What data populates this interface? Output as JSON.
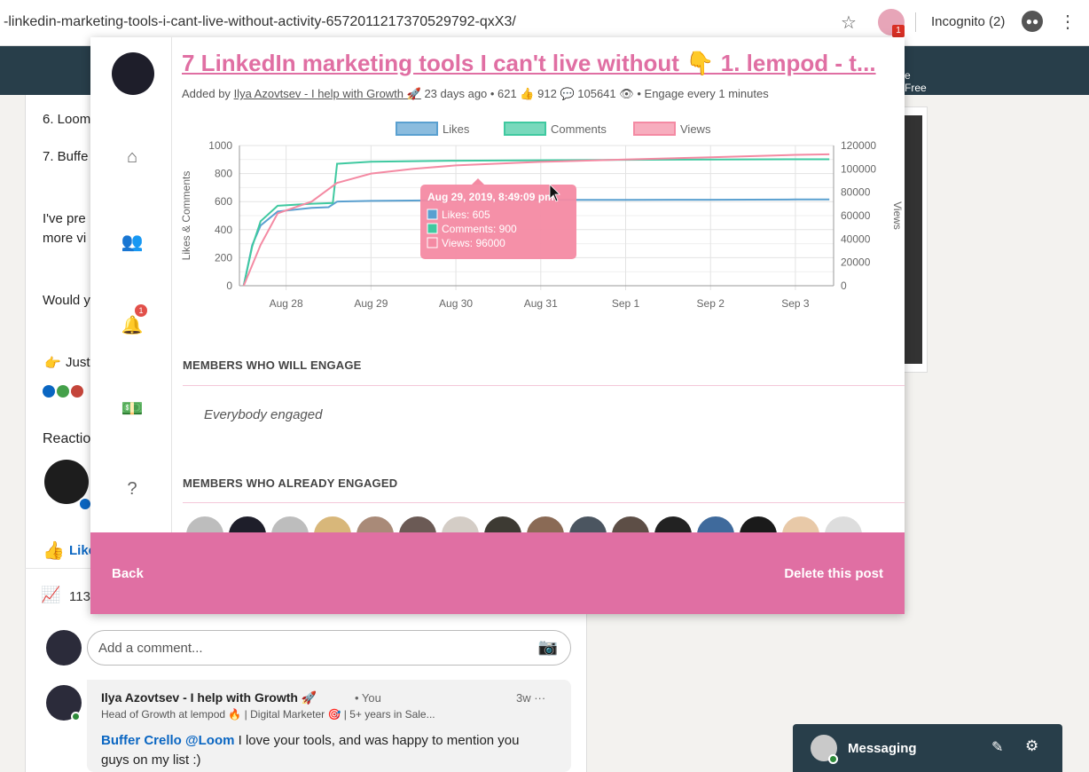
{
  "browser": {
    "url": "-linkedin-marketing-tools-i-cant-live-without-activity-6572011217370529792-qxX3/",
    "star_icon": "star-icon",
    "extension_badge": "1",
    "incognito_label": "Incognito (2)",
    "menu_icon": "kebab-icon"
  },
  "linkedin_nav": {
    "right_text_line1": "e",
    "right_text_line2": "Free"
  },
  "feed": {
    "lines": [
      "6. Loom",
      "7. Buffe",
      "I've pre",
      "more vi",
      "Would y",
      "Just"
    ],
    "reactions_label": "Reactio",
    "like_label": "Like",
    "stats_count": "113",
    "comment_placeholder": "Add a comment...",
    "comment": {
      "author": "Ilya Azovtsev - I help with Growth 🚀",
      "you": "• You",
      "time": "3w ···",
      "headline": "Head of Growth at lempod 🔥 | Digital Marketer 🎯 | 5+ years in Sale...",
      "mention1": "Buffer Crello",
      "mention2": "@Loom",
      "text": "I love your tools, and was happy to mention you guys on my list :)"
    }
  },
  "messaging": {
    "label": "Messaging"
  },
  "popup": {
    "title": "7 LinkedIn marketing tools I can't live without 👇 1. lempod - t...",
    "meta_prefix": "Added by",
    "meta_author": "Ilya Azovtsev - I help with Growth 🚀",
    "meta_rest": "23 days ago • 621 👍 912 💬 105641 👁 • Engage every 1 minutes",
    "notification_count": "1",
    "section_will_engage": "MEMBERS WHO WILL ENGAGE",
    "everybody_engaged": "Everybody engaged",
    "section_already_engaged": "MEMBERS WHO ALREADY ENGAGED",
    "back_label": "Back",
    "delete_label": "Delete this post",
    "accent_color": "#e06fa3"
  },
  "chart_data": {
    "type": "line",
    "x_labels": [
      "Aug 28",
      "Aug 29",
      "Aug 30",
      "Aug 31",
      "Sep 1",
      "Sep 2",
      "Sep 3"
    ],
    "ylabel_left": "Likes & Comments",
    "ylabel_right": "Views",
    "ylim_left": [
      0,
      1000
    ],
    "ylim_right": [
      0,
      120000
    ],
    "left_ticks": [
      0,
      200,
      400,
      600,
      800,
      1000
    ],
    "right_ticks": [
      0,
      20000,
      40000,
      60000,
      80000,
      100000,
      120000
    ],
    "legend_position": "top",
    "series": [
      {
        "name": "Likes",
        "axis": "left",
        "color": "#5aa0d0",
        "points": [
          [
            -0.5,
            0
          ],
          [
            -0.4,
            290
          ],
          [
            -0.3,
            430
          ],
          [
            -0.1,
            530
          ],
          [
            0.3,
            555
          ],
          [
            0.5,
            560
          ],
          [
            0.6,
            600
          ],
          [
            1.0,
            605
          ],
          [
            2.0,
            610
          ],
          [
            3.0,
            612
          ],
          [
            4.0,
            612
          ],
          [
            5.0,
            613
          ],
          [
            6.0,
            615
          ],
          [
            6.4,
            615
          ]
        ]
      },
      {
        "name": "Comments",
        "axis": "left",
        "color": "#3fc9a0",
        "points": [
          [
            -0.5,
            0
          ],
          [
            -0.4,
            280
          ],
          [
            -0.3,
            460
          ],
          [
            -0.1,
            570
          ],
          [
            0.3,
            585
          ],
          [
            0.55,
            590
          ],
          [
            0.6,
            870
          ],
          [
            1.0,
            885
          ],
          [
            2.0,
            892
          ],
          [
            3.0,
            895
          ],
          [
            4.0,
            898
          ],
          [
            5.0,
            900
          ],
          [
            6.0,
            902
          ],
          [
            6.4,
            902
          ]
        ]
      },
      {
        "name": "Views",
        "axis": "right",
        "color": "#f48aa3",
        "points": [
          [
            -0.5,
            0
          ],
          [
            -0.3,
            35000
          ],
          [
            -0.1,
            62000
          ],
          [
            0.3,
            72000
          ],
          [
            0.6,
            88000
          ],
          [
            1.0,
            96000
          ],
          [
            1.5,
            100000
          ],
          [
            2.0,
            103000
          ],
          [
            3.0,
            106000
          ],
          [
            4.0,
            108000
          ],
          [
            5.0,
            110000
          ],
          [
            6.0,
            112000
          ],
          [
            6.4,
            112500
          ]
        ]
      }
    ],
    "tooltip": {
      "title": "Aug 29, 2019, 8:49:09 pm",
      "lines": [
        "Likes: 605",
        "Comments: 900",
        "Views: 96000"
      ],
      "colors": [
        "#5aa0d0",
        "#3fc9a0",
        "#f48aa3"
      ]
    }
  }
}
